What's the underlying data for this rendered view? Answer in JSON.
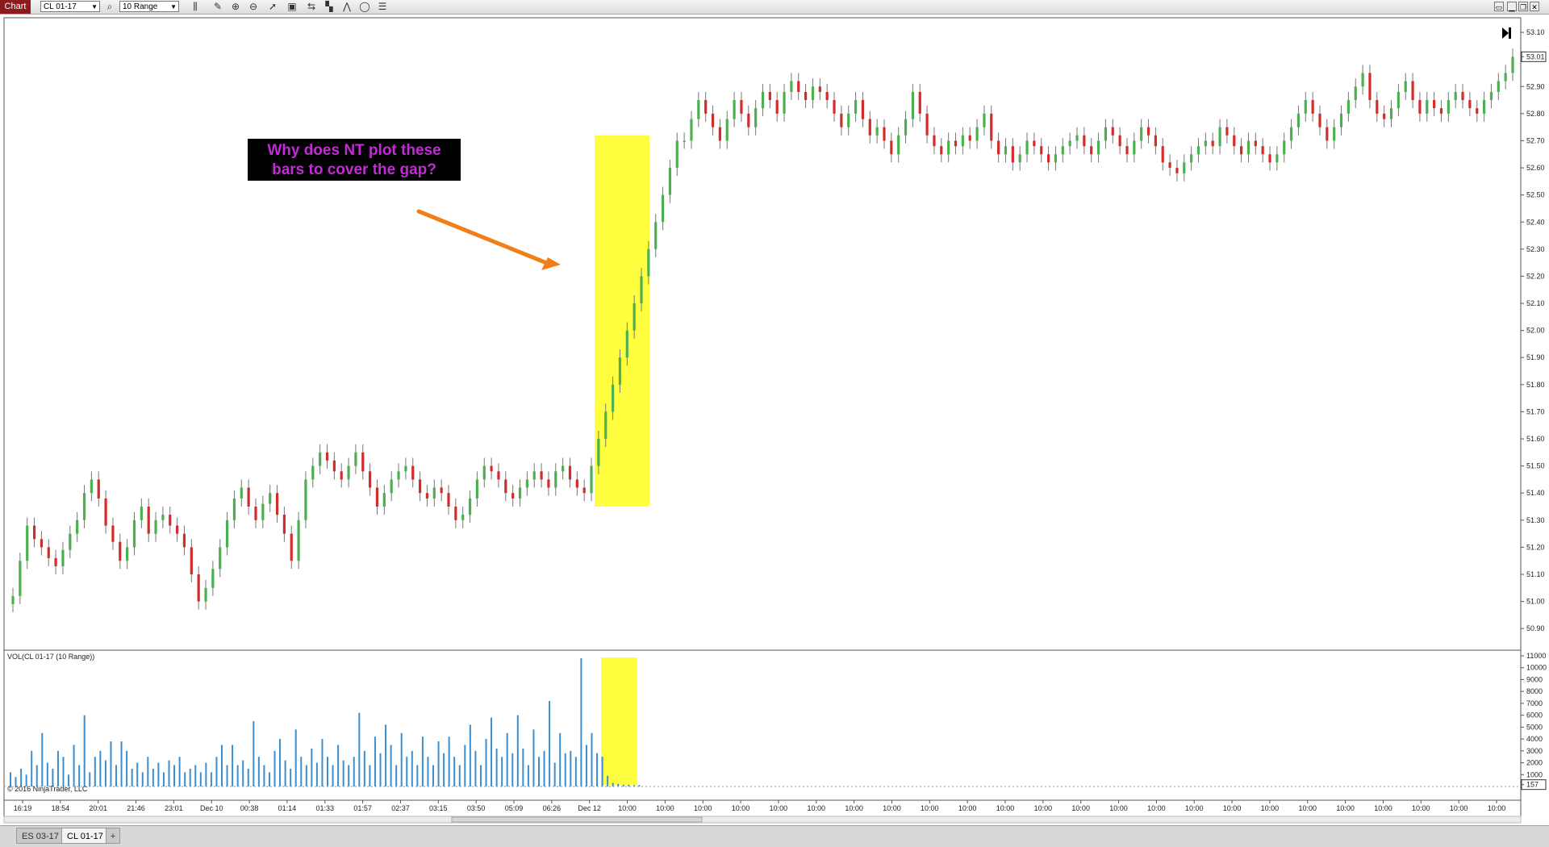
{
  "toolbar": {
    "chart_tab": "Chart",
    "instrument": "CL 01-17",
    "interval": "10 Range"
  },
  "annotation": {
    "line1": "Why does NT plot these",
    "line2": "bars to cover the gap?"
  },
  "copyright": "© 2016 NinjaTrader, LLC",
  "volume_label": "VOL(CL 01-17 (10 Range))",
  "tabs": [
    "ES 03-17",
    "CL 01-17"
  ],
  "add_tab": "+",
  "colors": {
    "up": "#4caf50",
    "down": "#d42b2b",
    "volume": "#3b8fd0",
    "highlight": "#ffff40",
    "annotation_text": "#c22bd6",
    "arrow": "#f07f1a"
  },
  "chart_data": [
    {
      "type": "candlestick",
      "title": "",
      "y_ticks": [
        "53.10",
        "53.01",
        "52.90",
        "52.80",
        "52.70",
        "52.60",
        "52.50",
        "52.40",
        "52.30",
        "52.20",
        "52.10",
        "52.00",
        "51.90",
        "51.80",
        "51.70",
        "51.60",
        "51.50",
        "51.40",
        "51.30",
        "51.20",
        "51.10",
        "51.00",
        "50.90"
      ],
      "ylim": [
        50.85,
        53.13
      ],
      "last_price": "53.01",
      "x_tick_labels": [
        "16:19",
        "18:54",
        "20:01",
        "21:46",
        "23:01",
        "Dec 10",
        "00:38",
        "01:14",
        "01:33",
        "01:57",
        "02:37",
        "03:15",
        "03:50",
        "05:09",
        "06:26",
        "Dec 12",
        "10:00",
        "10:00",
        "10:00",
        "10:00",
        "10:00",
        "10:00",
        "10:00",
        "10:00",
        "10:00",
        "10:00",
        "10:00",
        "10:00",
        "10:00",
        "10:00",
        "10:00",
        "10:00",
        "10:00",
        "10:00",
        "10:00",
        "10:00",
        "10:00",
        "10:00",
        "10:00",
        "10:00"
      ],
      "highlight_price_range": [
        51.35,
        52.72
      ],
      "close_series": [
        51.02,
        51.15,
        51.28,
        51.23,
        51.2,
        51.16,
        51.13,
        51.19,
        51.25,
        51.3,
        51.4,
        51.45,
        51.38,
        51.28,
        51.22,
        51.15,
        51.2,
        51.3,
        51.35,
        51.25,
        51.3,
        51.32,
        51.28,
        51.25,
        51.2,
        51.1,
        51.0,
        51.05,
        51.12,
        51.2,
        51.3,
        51.38,
        51.42,
        51.35,
        51.3,
        51.36,
        51.4,
        51.32,
        51.25,
        51.15,
        51.3,
        51.45,
        51.5,
        51.55,
        51.52,
        51.48,
        51.45,
        51.5,
        51.55,
        51.48,
        51.42,
        51.35,
        51.4,
        51.45,
        51.48,
        51.5,
        51.45,
        51.4,
        51.38,
        51.42,
        51.4,
        51.35,
        51.3,
        51.32,
        51.38,
        51.45,
        51.5,
        51.48,
        51.45,
        51.4,
        51.38,
        51.42,
        51.45,
        51.48,
        51.45,
        51.42,
        51.48,
        51.5,
        51.45,
        51.42,
        51.4,
        51.5,
        51.6,
        51.7,
        51.8,
        51.9,
        52.0,
        52.1,
        52.2,
        52.3,
        52.4,
        52.5,
        52.6,
        52.7,
        52.7,
        52.78,
        52.85,
        52.8,
        52.75,
        52.7,
        52.78,
        52.85,
        52.8,
        52.75,
        52.82,
        52.88,
        52.85,
        52.8,
        52.88,
        52.92,
        52.88,
        52.85,
        52.9,
        52.88,
        52.85,
        52.8,
        52.75,
        52.8,
        52.85,
        52.78,
        52.72,
        52.75,
        52.7,
        52.65,
        52.72,
        52.78,
        52.88,
        52.8,
        52.72,
        52.68,
        52.65,
        52.7,
        52.68,
        52.72,
        52.7,
        52.75,
        52.8,
        52.7,
        52.65,
        52.68,
        52.62,
        52.65,
        52.7,
        52.68,
        52.65,
        52.62,
        52.65,
        52.68,
        52.7,
        52.72,
        52.68,
        52.65,
        52.7,
        52.75,
        52.72,
        52.68,
        52.65,
        52.7,
        52.75,
        52.72,
        52.68,
        52.62,
        52.6,
        52.58,
        52.62,
        52.65,
        52.68,
        52.7,
        52.68,
        52.75,
        52.72,
        52.68,
        52.65,
        52.7,
        52.68,
        52.65,
        52.62,
        52.65,
        52.7,
        52.75,
        52.8,
        52.85,
        52.8,
        52.75,
        52.7,
        52.75,
        52.8,
        52.85,
        52.9,
        52.95,
        52.85,
        52.8,
        52.78,
        52.82,
        52.88,
        52.92,
        52.85,
        52.8,
        52.85,
        52.82,
        52.8,
        52.85,
        52.88,
        52.85,
        52.82,
        52.8,
        52.85,
        52.88,
        52.92,
        52.95,
        53.01
      ]
    },
    {
      "type": "bar",
      "title": "VOL(CL 01-17 (10 Range))",
      "y_ticks": [
        "11000",
        "10000",
        "9000",
        "8000",
        "7000",
        "6000",
        "5000",
        "4000",
        "3000",
        "2000",
        "1000",
        "157"
      ],
      "ylim": [
        0,
        11000
      ],
      "last_value": "157",
      "values": [
        1200,
        800,
        1500,
        1000,
        3000,
        1800,
        4500,
        2000,
        1500,
        3000,
        2500,
        1000,
        3500,
        1800,
        6000,
        1200,
        2500,
        3000,
        2200,
        3800,
        1800,
        3800,
        3000,
        1500,
        2000,
        1200,
        2500,
        1500,
        2000,
        1200,
        2200,
        1800,
        2500,
        1200,
        1500,
        1800,
        1200,
        2000,
        1200,
        2500,
        3500,
        1800,
        3500,
        1800,
        2200,
        1500,
        5500,
        2500,
        1800,
        1200,
        3000,
        4000,
        2200,
        1500,
        4800,
        2500,
        1800,
        3200,
        2000,
        4000,
        2500,
        1800,
        3500,
        2200,
        1800,
        2500,
        6200,
        3000,
        1800,
        4200,
        2800,
        5200,
        3500,
        1800,
        4500,
        2500,
        3000,
        1800,
        4200,
        2500,
        1800,
        3800,
        2800,
        4200,
        2500,
        1800,
        3500,
        5200,
        3000,
        1800,
        4000,
        5800,
        3200,
        2500,
        4500,
        2800,
        6000,
        3200,
        1800,
        4800,
        2500,
        3000,
        7200,
        2000,
        4500,
        2800,
        3000,
        2500,
        10800,
        3500,
        4500,
        2800,
        2500,
        900,
        300,
        200,
        150,
        150,
        120,
        120
      ]
    }
  ]
}
